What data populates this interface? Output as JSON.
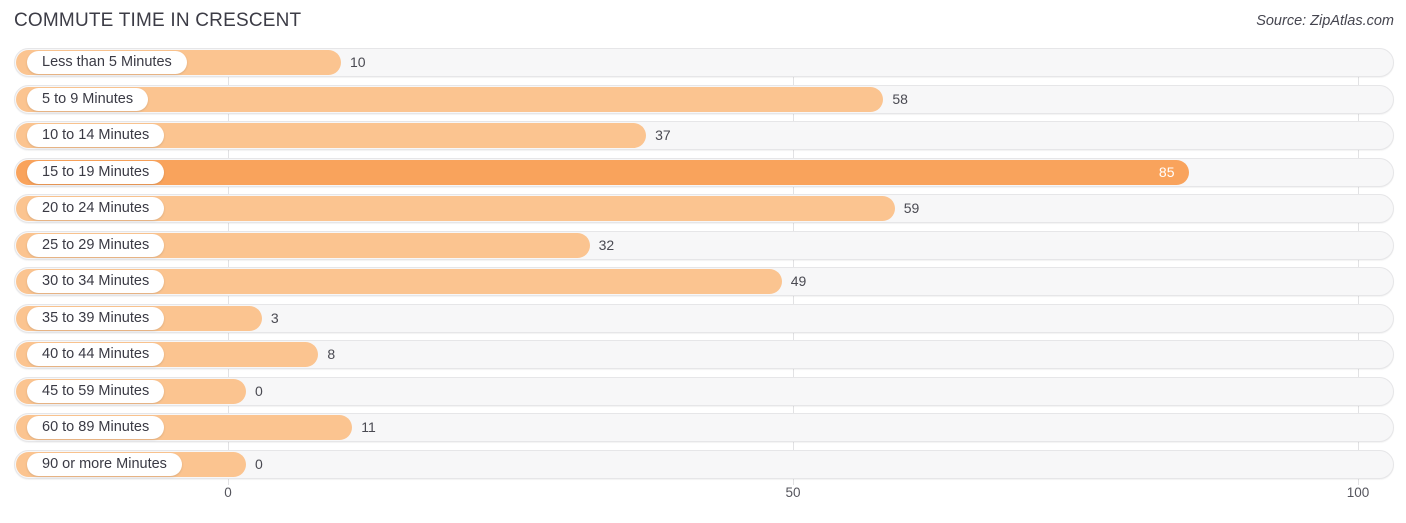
{
  "header": {
    "title": "COMMUTE TIME IN CRESCENT",
    "source": "Source: ZipAtlas.com"
  },
  "colors": {
    "bar": "#fbc490",
    "bar_max": "#f9a35c",
    "track": "#f7f7f8",
    "grid": "#e2e2e4",
    "text": "#3a3a44"
  },
  "chart_data": {
    "type": "bar",
    "orientation": "horizontal",
    "title": "COMMUTE TIME IN CRESCENT",
    "xlabel": "",
    "ylabel": "",
    "xlim": [
      0,
      100
    ],
    "xticks": [
      0,
      50,
      100
    ],
    "xtick_labels": [
      "0",
      "50",
      "100"
    ],
    "grid": true,
    "legend": "none",
    "categories": [
      "Less than 5 Minutes",
      "5 to 9 Minutes",
      "10 to 14 Minutes",
      "15 to 19 Minutes",
      "20 to 24 Minutes",
      "25 to 29 Minutes",
      "30 to 34 Minutes",
      "35 to 39 Minutes",
      "40 to 44 Minutes",
      "45 to 59 Minutes",
      "60 to 89 Minutes",
      "90 or more Minutes"
    ],
    "values": [
      10,
      58,
      37,
      85,
      59,
      32,
      49,
      3,
      8,
      0,
      11,
      0
    ],
    "value_labels": [
      "10",
      "58",
      "37",
      "85",
      "59",
      "32",
      "49",
      "3",
      "8",
      "0",
      "11",
      "0"
    ],
    "max_value": 85,
    "max_index": 3
  }
}
